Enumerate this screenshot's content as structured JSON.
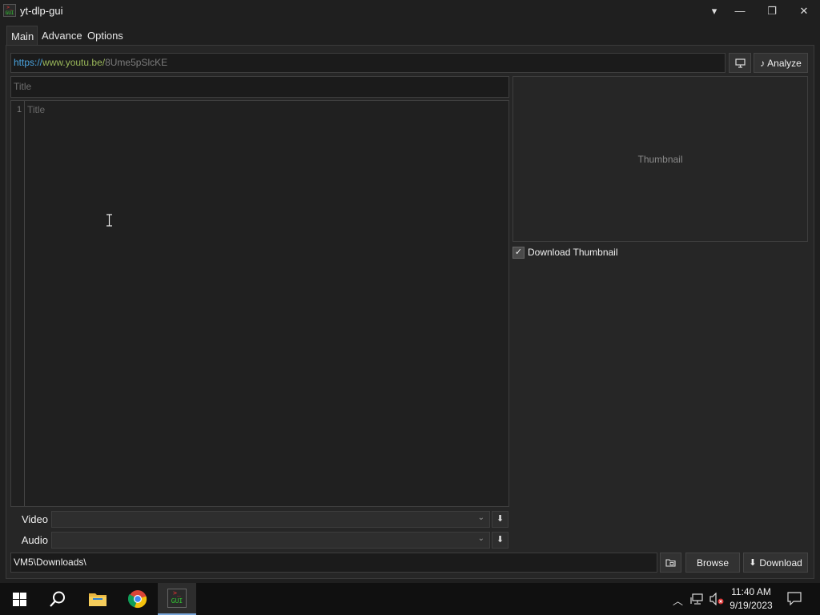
{
  "window": {
    "title": "yt-dlp-gui",
    "controls": {
      "dropdown": "▾",
      "minimize": "—",
      "maximize": "❐",
      "close": "✕"
    }
  },
  "tabs": [
    {
      "label": "Main",
      "active": true
    },
    {
      "label": "Advance",
      "active": false
    },
    {
      "label": "Options",
      "active": false
    }
  ],
  "url": {
    "scheme": "https://",
    "domain": "www.youtu.be/",
    "path": "8Ume5pSlcKE"
  },
  "toolbar": {
    "monitor_icon": "monitor-icon",
    "analyze_label": "Analyze"
  },
  "title_field": {
    "placeholder": "Title"
  },
  "editor": {
    "line_number": "1",
    "placeholder": "Title"
  },
  "thumbnail": {
    "label": "Thumbnail"
  },
  "download_thumbnail": {
    "label": "Download Thumbnail",
    "checked": true
  },
  "formats": {
    "video_label": "Video",
    "audio_label": "Audio"
  },
  "path": {
    "value": "VM5\\Downloads\\"
  },
  "actions": {
    "browse_label": "Browse",
    "download_label": "Download"
  },
  "taskbar": {
    "time": "11:40 AM",
    "date": "9/19/2023"
  },
  "colors": {
    "url_scheme": "#4aa3df",
    "url_domain": "#9ab85a",
    "url_path": "#7c7c7c",
    "accent": "#79a6d9"
  }
}
